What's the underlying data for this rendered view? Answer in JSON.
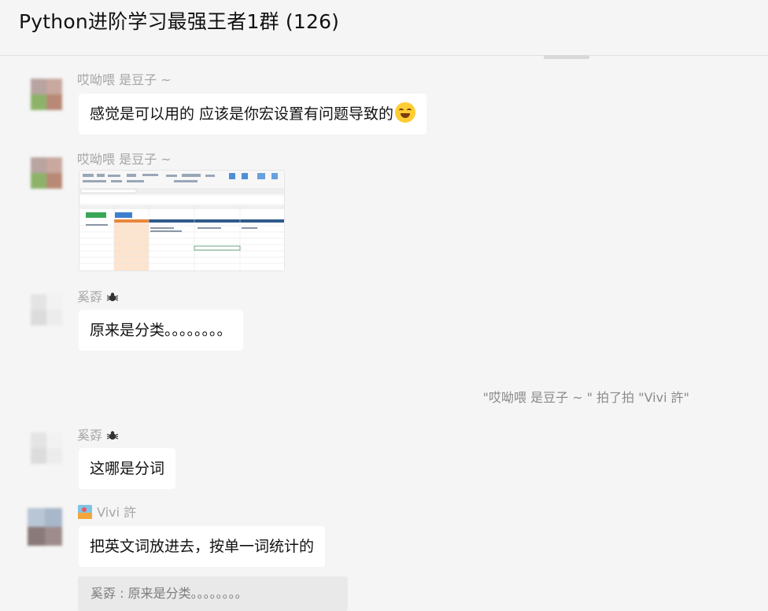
{
  "header": {
    "title": "Python进阶学习最强王者1群 (126)"
  },
  "messages": [
    {
      "sender": "哎呦喂  是豆子 ~",
      "text": "感觉是可以用的 应该是你宏设置有问题导致的"
    },
    {
      "sender": "哎呦喂  是豆子 ~",
      "image": "excel-screenshot"
    },
    {
      "sender": "奚孬",
      "text": "原来是分类。。。。。。。。"
    },
    {
      "system": "\"哎呦喂  是豆子 ~ \" 拍了拍 \"Vivi 許\""
    },
    {
      "sender": "奚孬",
      "text": "这哪是分词"
    },
    {
      "sender": "Vivi 許",
      "text": "把英文词放进去，按单一词统计的",
      "quote": "奚孬 : 原来是分类。。。。。。。。"
    }
  ],
  "colors": {
    "background": "#f5f5f5",
    "bubble": "#ffffff",
    "sender": "#a6a6a6",
    "quote_bg": "#e9e9e9"
  },
  "icons": {
    "emoji_laugh": "laughing-emoji-icon",
    "spider": "spider-icon",
    "vivi": "photo-avatar-icon"
  }
}
